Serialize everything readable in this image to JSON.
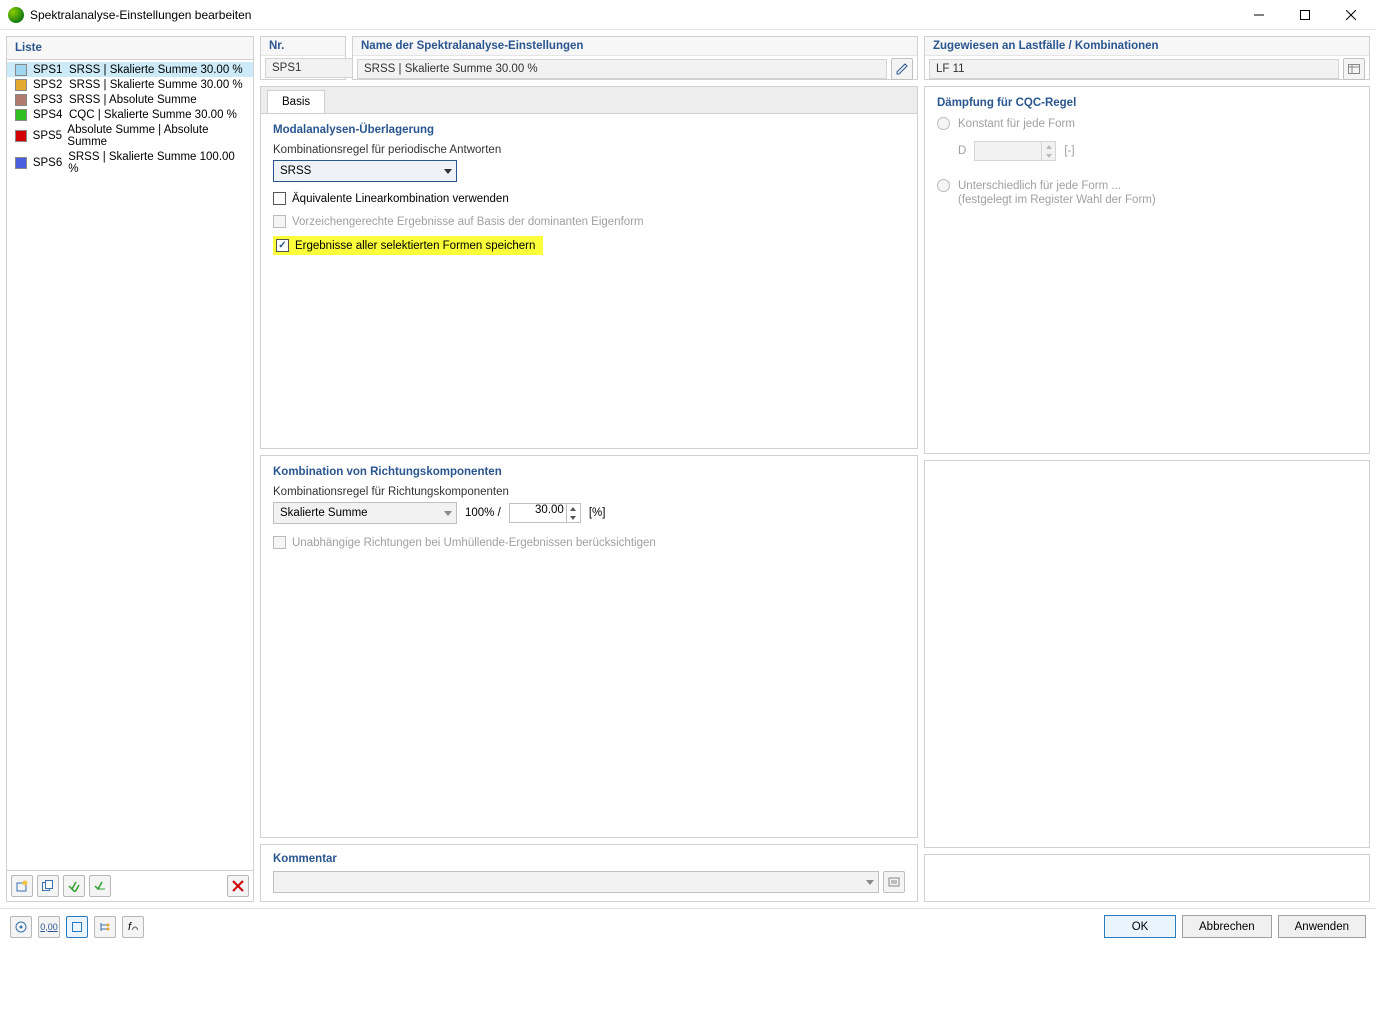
{
  "window": {
    "title": "Spektralanalyse-Einstellungen bearbeiten"
  },
  "left": {
    "header": "Liste",
    "items": [
      {
        "code": "SPS1",
        "label": "SRSS | Skalierte Summe 30.00 %",
        "color": "#9fd7f0",
        "selected": true
      },
      {
        "code": "SPS2",
        "label": "SRSS | Skalierte Summe 30.00 %",
        "color": "#e3a92f",
        "selected": false
      },
      {
        "code": "SPS3",
        "label": "SRSS | Absolute Summe",
        "color": "#b07a6f",
        "selected": false
      },
      {
        "code": "SPS4",
        "label": "CQC | Skalierte Summe 30.00 %",
        "color": "#2fbf1f",
        "selected": false
      },
      {
        "code": "SPS5",
        "label": "Absolute Summe | Absolute Summe",
        "color": "#d40000",
        "selected": false
      },
      {
        "code": "SPS6",
        "label": "SRSS | Skalierte Summe 100.00 %",
        "color": "#4a5fe0",
        "selected": false
      }
    ]
  },
  "top": {
    "nr_label": "Nr.",
    "nr_value": "SPS1",
    "name_label": "Name der Spektralanalyse-Einstellungen",
    "name_value": "SRSS | Skalierte Summe 30.00 %",
    "assigned_label": "Zugewiesen an Lastfälle / Kombinationen",
    "assigned_value": "LF 11"
  },
  "tabs": {
    "basis": "Basis"
  },
  "modal": {
    "title": "Modalanalysen-Überlagerung",
    "rule_label": "Kombinationsregel für periodische Antworten",
    "rule_value": "SRSS",
    "equiv_label": "Äquivalente Linearkombination verwenden",
    "signed_label": "Vorzeichengerechte Ergebnisse auf Basis der dominanten Eigenform",
    "save_label": "Ergebnisse aller selektierten Formen speichern"
  },
  "damping": {
    "title": "Dämpfung für CQC-Regel",
    "const_label": "Konstant für jede Form",
    "d_label": "D",
    "d_unit": "[-]",
    "diff_label": "Unterschiedlich für jede Form ...",
    "diff_sub": "(festgelegt im Register Wahl der Form)"
  },
  "direction": {
    "title": "Kombination von Richtungskomponenten",
    "rule_label": "Kombinationsregel für Richtungskomponenten",
    "rule_value": "Skalierte Summe",
    "pct_prefix": "100% /",
    "pct_value": "30.00",
    "pct_unit": "[%]",
    "indep_label": "Unabhängige Richtungen bei Umhüllende-Ergebnissen berücksichtigen"
  },
  "comment": {
    "title": "Kommentar"
  },
  "footer": {
    "ok": "OK",
    "cancel": "Abbrechen",
    "apply": "Anwenden"
  }
}
